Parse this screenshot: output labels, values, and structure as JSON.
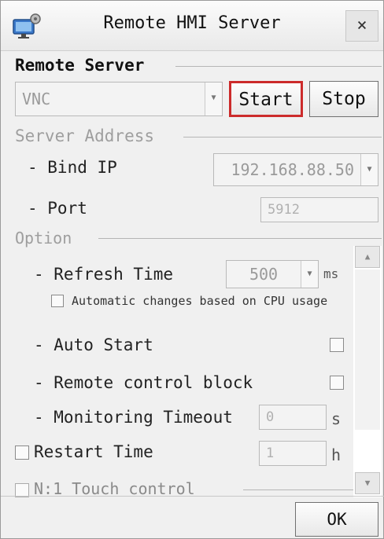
{
  "window": {
    "title": "Remote HMI Server",
    "close_label": "×"
  },
  "remote_server": {
    "group_label": "Remote Server",
    "server_type": "VNC",
    "start_label": "Start",
    "stop_label": "Stop",
    "highlight_color": "#cc2b2b"
  },
  "server_address": {
    "group_label": "Server Address",
    "bind_ip_label": "- Bind IP",
    "bind_ip_value": "192.168.88.50",
    "port_label": "- Port",
    "port_value": "5912"
  },
  "option": {
    "group_label": "Option",
    "refresh_time_label": "- Refresh Time",
    "refresh_time_value": "500",
    "refresh_time_unit": "ms",
    "auto_cpu_label": "Automatic changes based on CPU usage",
    "auto_start_label": "- Auto Start",
    "remote_block_label": "- Remote control block",
    "monitoring_timeout_label": "- Monitoring Timeout",
    "monitoring_timeout_value": "0",
    "monitoring_timeout_unit": "s",
    "restart_time_label": "Restart Time",
    "restart_time_value": "1",
    "restart_time_unit": "h",
    "touch_control_label": "N:1 Touch control"
  },
  "footer": {
    "ok_label": "OK"
  }
}
